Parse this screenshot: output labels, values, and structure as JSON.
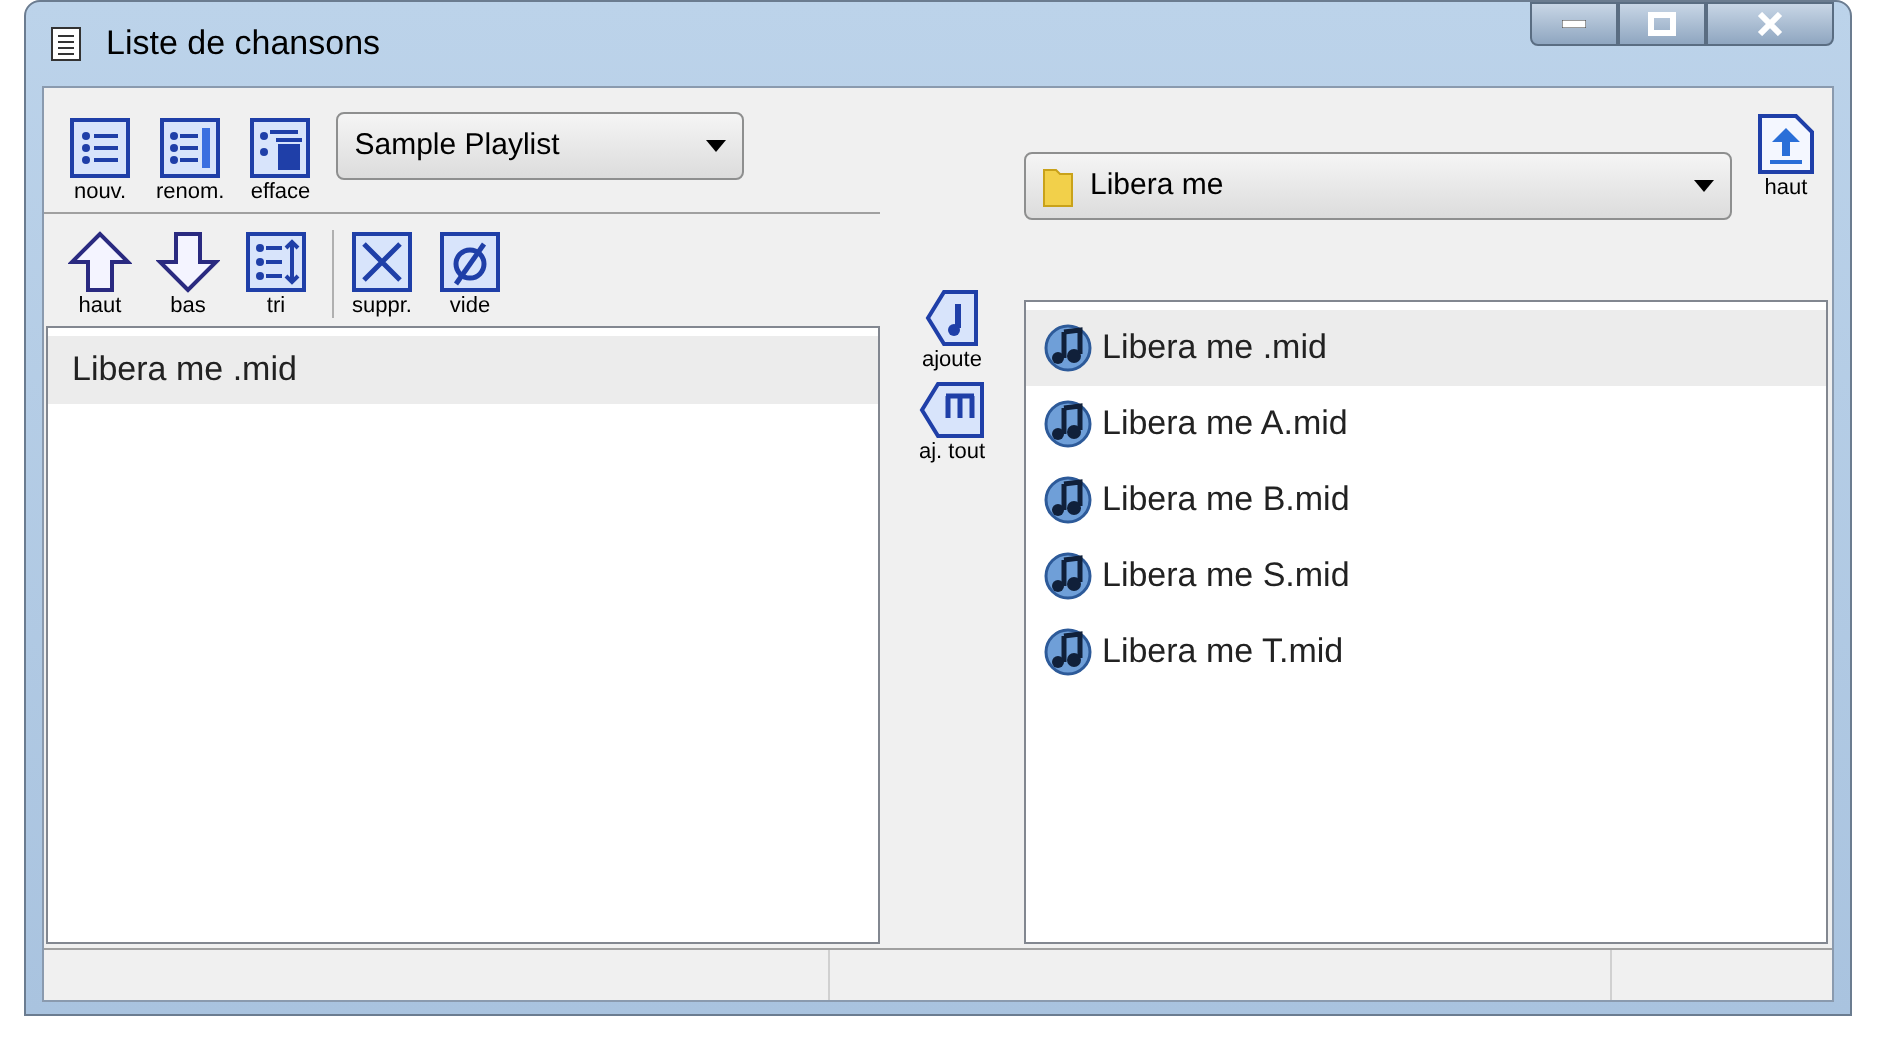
{
  "window": {
    "title": "Liste de chansons"
  },
  "playlist_toolbar": [
    {
      "kind": "new",
      "label": "nouv."
    },
    {
      "kind": "rename",
      "label": "renom."
    },
    {
      "kind": "delete",
      "label": "efface"
    }
  ],
  "playlist_dropdown": {
    "value": "Sample Playlist"
  },
  "folder_dropdown": {
    "value": "Libera me"
  },
  "folder_up": {
    "kind": "up-folder",
    "label": "haut"
  },
  "list_toolbar": [
    {
      "kind": "up",
      "label": "haut"
    },
    {
      "kind": "down",
      "label": "bas"
    },
    {
      "kind": "sort",
      "label": "tri"
    },
    {
      "kind": "remove",
      "label": "suppr."
    },
    {
      "kind": "clear",
      "label": "vide"
    }
  ],
  "playlist_items": [
    {
      "name": "Libera me .mid",
      "selected": true
    }
  ],
  "transfer_buttons": [
    {
      "kind": "add",
      "label": "ajoute"
    },
    {
      "kind": "add-all",
      "label": "aj. tout"
    }
  ],
  "files": [
    {
      "name": "Libera me .mid",
      "selected": true
    },
    {
      "name": "Libera me A.mid",
      "selected": false
    },
    {
      "name": "Libera me B.mid",
      "selected": false
    },
    {
      "name": "Libera me S.mid",
      "selected": false
    },
    {
      "name": "Libera me T.mid",
      "selected": false
    }
  ]
}
